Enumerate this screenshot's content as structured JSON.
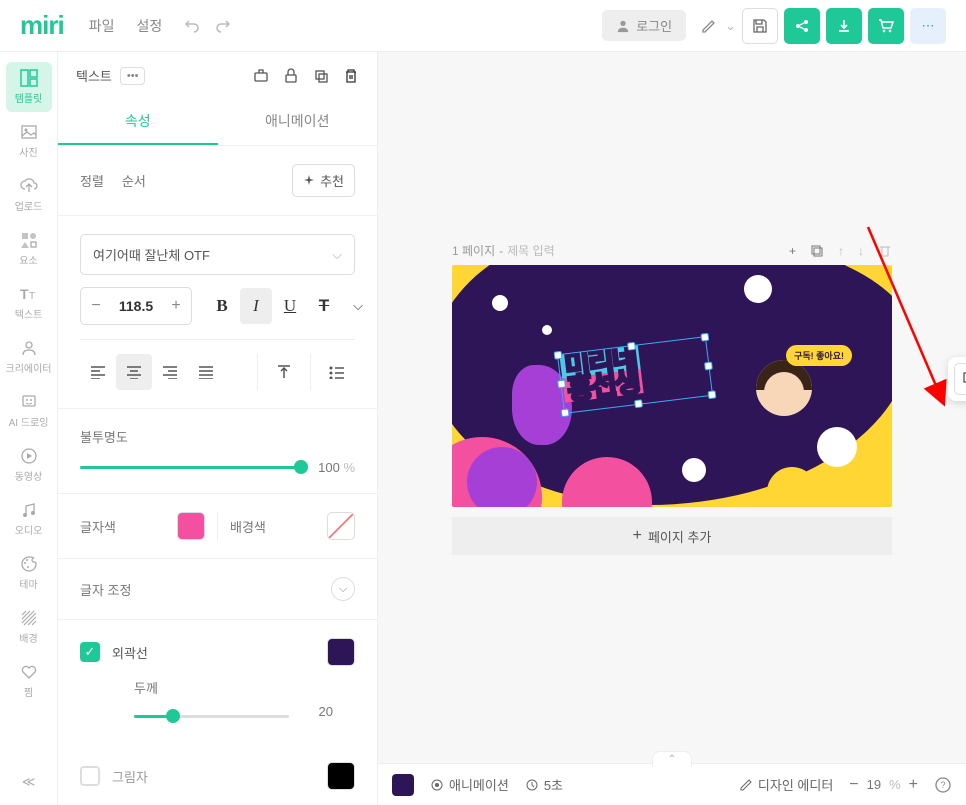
{
  "top": {
    "logo": "miri",
    "file": "파일",
    "settings": "설정",
    "login": "로그인"
  },
  "rail": {
    "template": "템플릿",
    "photo": "사진",
    "upload": "업로드",
    "element": "요소",
    "text": "텍스트",
    "creator": "크리에이터",
    "ai_drawing": "AI 드로잉",
    "video": "동영상",
    "audio": "오디오",
    "theme": "테마",
    "background": "배경",
    "favorite": "찜"
  },
  "panel": {
    "title": "텍스트",
    "tab_prop": "속성",
    "tab_anim": "애니메이션",
    "align": "정렬",
    "order": "순서",
    "recommend": "추천",
    "font": "여기어때 잘난체 OTF",
    "size": "118.5",
    "opacity_label": "불투명도",
    "opacity_val": "100",
    "opacity_unit": "%",
    "text_color": "글자색",
    "bg_color": "배경색",
    "char_adjust": "글자 조정",
    "outline": "외곽선",
    "thickness": "두께",
    "thickness_val": "20",
    "shadow": "그림자"
  },
  "canvas": {
    "page_prefix": "1 페이지",
    "page_sep": "-",
    "title_placeholder": "제목 입력",
    "text_top": "미리네",
    "text_bottom": "흥선생",
    "speech": "구독!\n좋아요!",
    "add_page": "페이지 추가"
  },
  "bottom": {
    "animation": "애니메이션",
    "duration": "5초",
    "editor": "디자인 에디터",
    "zoom": "19",
    "zoom_unit": "%"
  }
}
